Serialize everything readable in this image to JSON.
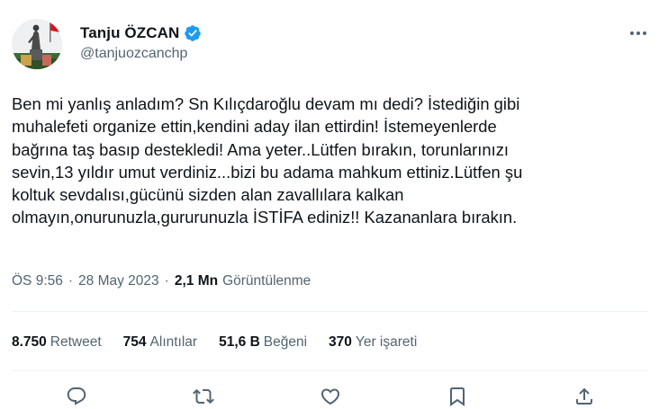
{
  "author": {
    "display_name": "Tanju ÖZCAN",
    "handle": "@tanjuozcanchp",
    "verified": true,
    "verified_color": "#1d9bf0",
    "avatar_icon": "profile-photo-statue-flag"
  },
  "menu": {
    "more_icon": "more-horizontal-icon"
  },
  "tweet": {
    "lines": [
      "Ben mi yanlış anladım? Sn Kılıçdaroğlu devam mı dedi? İstediğin gibi",
      "muhalefeti organize ettin,kendini aday ilan ettirdin! İstemeyenlerde",
      "bağrına taş basıp destekledi! Ama yeter..Lütfen bırakın, torunlarınızı",
      "sevin,13 yıldır umut verdiniz...bizi bu adama mahkum ettiniz.Lütfen şu",
      "koltuk sevdalısı,gücünü sizden alan zavallılara kalkan",
      "olmayın,onurunuzla,gururunuzla İSTİFA ediniz!! Kazananlara bırakın."
    ]
  },
  "meta": {
    "time": "ÖS 9:56",
    "separator": "·",
    "date": "28 May 2023",
    "views_count": "2,1 Mn",
    "views_label": "Görüntülenme"
  },
  "stats": {
    "retweets": {
      "count": "8.750",
      "label": "Retweet"
    },
    "quotes": {
      "count": "754",
      "label": "Alıntılar"
    },
    "likes": {
      "count": "51,6 B",
      "label": "Beğeni"
    },
    "bookmarks": {
      "count": "370",
      "label": "Yer işareti"
    }
  },
  "actions": [
    "reply-icon",
    "retweet-icon",
    "like-icon",
    "bookmark-icon",
    "share-icon"
  ],
  "colors": {
    "text": "#0f1419",
    "secondary": "#536471",
    "divider": "#eff3f4"
  }
}
